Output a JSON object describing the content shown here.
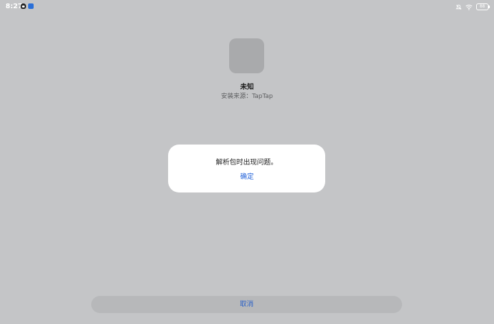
{
  "status_bar": {
    "time": "8:27",
    "left_icons": [
      "qq-icon",
      "app-notification-icon"
    ],
    "right_icons": [
      "mute-icon",
      "wifi-icon",
      "battery-icon"
    ],
    "battery_level": "88"
  },
  "app": {
    "name": "未知",
    "source": "安装来源：TapTap"
  },
  "dialog": {
    "message": "解析包时出现问题。",
    "confirm_label": "确定"
  },
  "footer": {
    "cancel_label": "取消"
  },
  "colors": {
    "background": "#c4c5c7",
    "accent": "#2463d9",
    "dialog": "#ffffff"
  }
}
